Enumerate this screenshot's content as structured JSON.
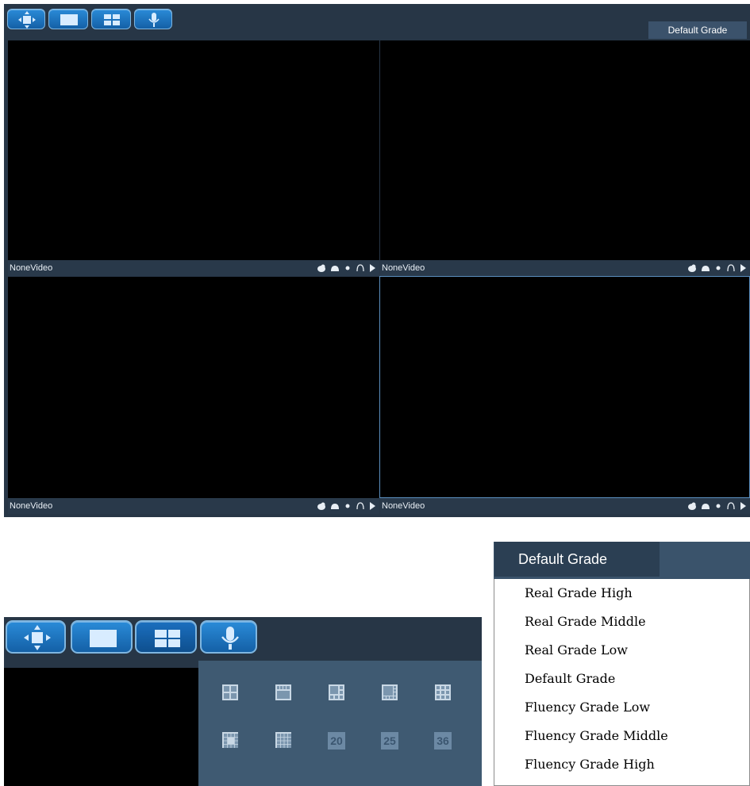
{
  "main_view": {
    "toolbar_buttons": [
      {
        "name": "ptz-control",
        "icon": "ptz-arrows-icon"
      },
      {
        "name": "single-view",
        "icon": "single-screen-icon"
      },
      {
        "name": "quad-view",
        "icon": "four-grid-icon"
      },
      {
        "name": "talk",
        "icon": "microphone-icon"
      }
    ],
    "grade_button": "Default Grade",
    "cells": [
      {
        "label": "NoneVideo"
      },
      {
        "label": "NoneVideo"
      },
      {
        "label": "NoneVideo"
      },
      {
        "label": "NoneVideo"
      }
    ],
    "cell_icons": [
      "snapshot-icon",
      "record-icon",
      "dot-icon",
      "audio-icon",
      "play-icon"
    ]
  },
  "layout_panel": {
    "layout_options_row1": [
      "4-grid",
      "top-1-plus-bottom",
      "6-grid",
      "8-grid",
      "9-grid"
    ],
    "layout_options_row2": [
      "13-grid",
      "16-grid",
      "20",
      "25",
      "36"
    ]
  },
  "grade_menu": {
    "selected": "Default Grade",
    "items": [
      "Real Grade High",
      "Real Grade Middle",
      "Real Grade Low",
      "Default Grade",
      "Fluency Grade Low",
      "Fluency Grade Middle",
      "Fluency Grade High"
    ]
  },
  "colors": {
    "panel_bg": "#273646",
    "button_blue": "#1e78c8",
    "active_cell_border": "#5b8fbf",
    "grid_bg": "#3f5a72"
  }
}
